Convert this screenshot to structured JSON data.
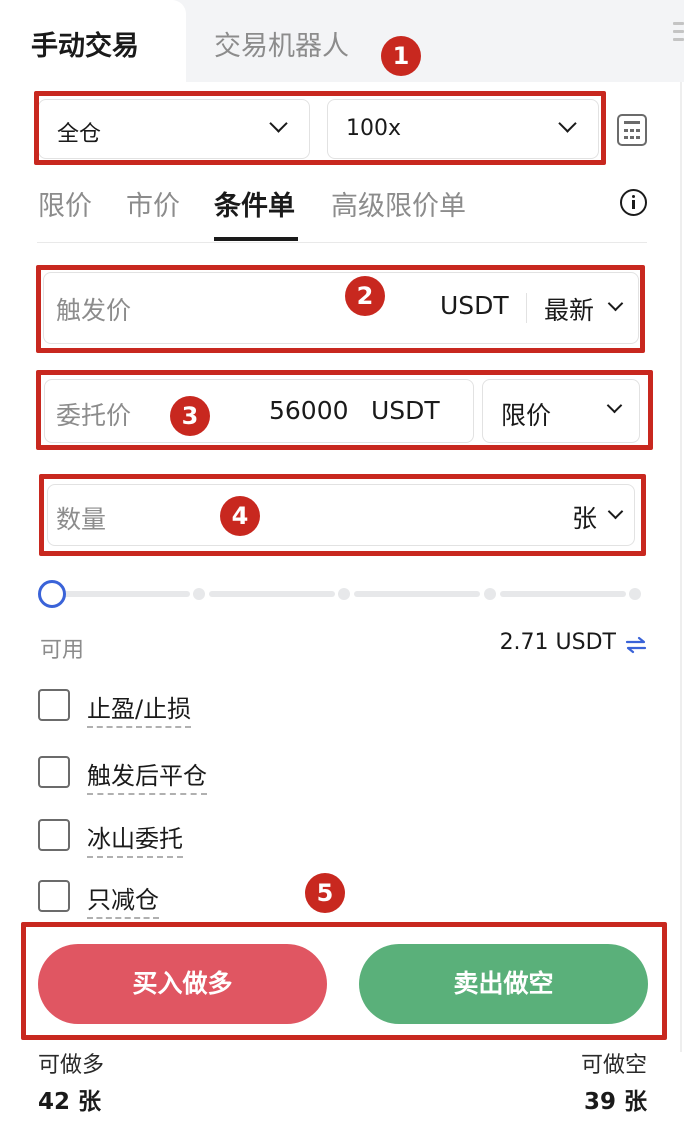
{
  "tabs": {
    "manual": "手动交易",
    "bot": "交易机器人"
  },
  "margin_mode": {
    "value": "全仓"
  },
  "leverage": {
    "value": "100x"
  },
  "order_types": [
    "限价",
    "市价",
    "条件单",
    "高级限价单"
  ],
  "trigger_price": {
    "label": "触发价",
    "unit": "USDT",
    "price_type": "最新"
  },
  "order_price": {
    "label": "委托价",
    "value": "56000",
    "unit": "USDT",
    "type": "限价"
  },
  "quantity": {
    "label": "数量",
    "unit": "张"
  },
  "slider": {
    "percent": 0
  },
  "available": {
    "label": "可用",
    "value": "2.71 USDT"
  },
  "options": [
    {
      "label": "止盈/止损",
      "checked": false
    },
    {
      "label": "触发后平仓",
      "checked": false
    },
    {
      "label": "冰山委托",
      "checked": false
    },
    {
      "label": "只减仓",
      "checked": false
    }
  ],
  "actions": {
    "buy": "买入做多",
    "sell": "卖出做空"
  },
  "capacity": {
    "long_label": "可做多",
    "long_value": "42 张",
    "short_label": "可做空",
    "short_value": "39 张"
  },
  "annotations": [
    "1",
    "2",
    "3",
    "4",
    "5"
  ],
  "colors": {
    "buy": "#e05662",
    "sell": "#5ab07a",
    "accent": "#3a63d8",
    "annotation": "#c8281f"
  },
  "icons": {
    "calculator": "calculator-icon",
    "info": "info-icon",
    "swap": "swap-icon",
    "chevron": "chevron-down-icon"
  }
}
